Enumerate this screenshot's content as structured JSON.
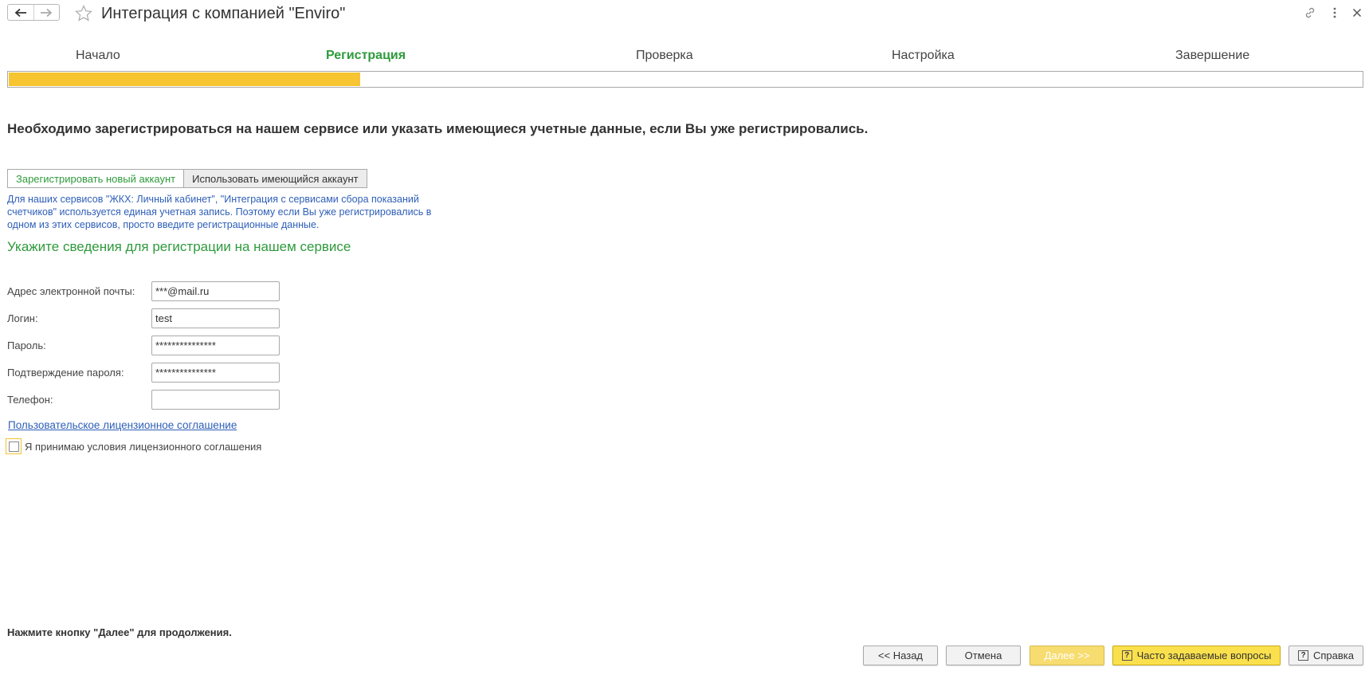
{
  "window": {
    "title": "Интеграция с компанией \"Enviro\""
  },
  "steps": [
    {
      "label": "Начало",
      "active": false
    },
    {
      "label": "Регистрация",
      "active": true
    },
    {
      "label": "Проверка",
      "active": false
    },
    {
      "label": "Настройка",
      "active": false
    },
    {
      "label": "Завершение",
      "active": false
    }
  ],
  "progress": {
    "value_percent": 26
  },
  "instruction": "Необходимо зарегистрироваться на нашем сервисе или указать имеющиеся учетные данные, если Вы уже регистрировались.",
  "tabs": [
    {
      "label": "Зарегистрировать новый аккаунт",
      "selected": true
    },
    {
      "label": "Использовать имеющийся аккаунт",
      "selected": false
    }
  ],
  "info_text": "Для наших сервисов \"ЖКХ: Личный кабинет\", \"Интеграция с сервисами сбора показаний счетчиков\" используется единая учетная запись. Поэтому если Вы уже регистрировались в одном из этих сервисов, просто введите регистрационные данные.",
  "section_title": "Укажите сведения для регистрации на нашем сервисе",
  "form": {
    "email_label": "Адрес электронной почты:",
    "email_value": "***@mail.ru",
    "login_label": "Логин:",
    "login_value": "test",
    "password_label": "Пароль:",
    "password_value": "***************",
    "confirm_label": "Подтверждение пароля:",
    "confirm_value": "***************",
    "phone_label": "Телефон:",
    "phone_value": ""
  },
  "license_link": "Пользовательское лицензионное соглашение",
  "accept_label": "Я принимаю условия лицензионного соглашения",
  "accept_checked": false,
  "footer_hint": "Нажмите кнопку \"Далее\" для продолжения.",
  "buttons": {
    "back": "<< Назад",
    "cancel": "Отмена",
    "next": "Далее >>",
    "faq": "Часто задаваемые вопросы",
    "help": "Справка"
  },
  "colors": {
    "accent_green": "#2e9a3c",
    "progress_yellow": "#f6c531",
    "link_blue": "#2e5fb8"
  }
}
